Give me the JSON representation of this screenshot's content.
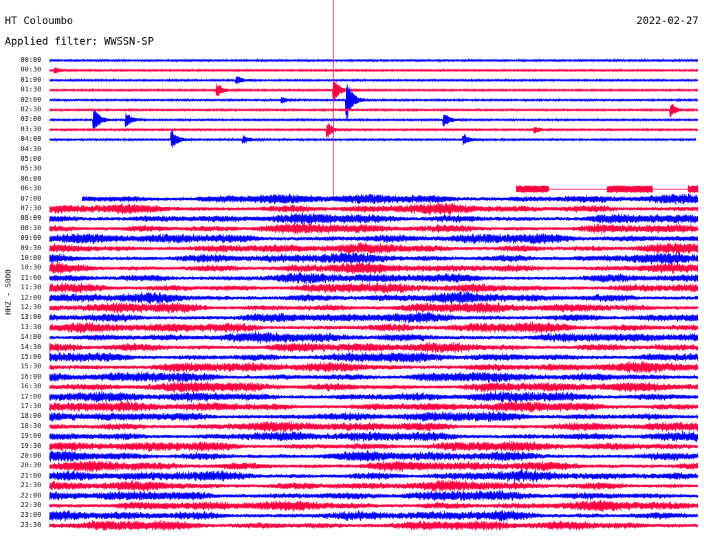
{
  "header": {
    "station": "HT Coloumbo",
    "date": "2022-02-27",
    "filter": "Applied filter: WWSSN-SP",
    "channel": "HHZ - 5000"
  },
  "colors": {
    "trace_a": "#0000ff",
    "trace_b": "#ff0040",
    "background": "#ffffff",
    "text": "#000000"
  },
  "chart_data": {
    "type": "line",
    "title": "HT Coloumbo",
    "date": "2022-02-27",
    "filter": "WWSSN-SP",
    "ylabel": "HHZ - 5000",
    "row_labels": [
      "00:00",
      "00:30",
      "01:00",
      "01:30",
      "02:00",
      "02:30",
      "03:00",
      "03:30",
      "04:00",
      "04:30",
      "05:00",
      "05:30",
      "06:00",
      "06:30",
      "07:00",
      "07:30",
      "08:00",
      "08:30",
      "09:00",
      "09:30",
      "10:00",
      "10:30",
      "11:00",
      "11:30",
      "12:00",
      "12:30",
      "13:00",
      "13:30",
      "14:00",
      "14:30",
      "15:00",
      "15:30",
      "16:00",
      "16:30",
      "17:00",
      "17:30",
      "18:00",
      "18:30",
      "19:00",
      "19:30",
      "20:00",
      "20:30",
      "21:00",
      "21:30",
      "22:00",
      "22:30",
      "23:00",
      "23:30"
    ],
    "trace_colors": [
      "#0000ff",
      "#ff0040"
    ],
    "rows_with_data_00_to_04": 9,
    "rows_without_data": [
      "04:30",
      "05:00",
      "05:30",
      "06:00"
    ],
    "high_noise_from": "07:00",
    "events": [
      {
        "row": "00:30",
        "t": 0.01,
        "amplitude": 0.5,
        "color": "#ff0040"
      },
      {
        "row": "01:00",
        "t": 0.29,
        "amplitude": 0.6
      },
      {
        "row": "01:30",
        "t": 0.26,
        "amplitude": 1.0
      },
      {
        "row": "01:30",
        "t": 0.44,
        "amplitude": 1.6
      },
      {
        "row": "02:00",
        "t": 0.36,
        "amplitude": 0.4
      },
      {
        "row": "02:00",
        "t": 0.46,
        "amplitude": 3.0
      },
      {
        "row": "02:30",
        "t": 0.96,
        "amplitude": 1.0
      },
      {
        "row": "03:00",
        "t": 0.07,
        "amplitude": 2.0
      },
      {
        "row": "03:00",
        "t": 0.12,
        "amplitude": 1.0
      },
      {
        "row": "03:00",
        "t": 0.61,
        "amplitude": 1.0
      },
      {
        "row": "03:30",
        "t": 0.43,
        "amplitude": 1.1
      },
      {
        "row": "03:30",
        "t": 0.75,
        "amplitude": 0.5
      },
      {
        "row": "04:00",
        "t": 0.19,
        "amplitude": 1.4
      },
      {
        "row": "04:00",
        "t": 0.3,
        "amplitude": 0.6
      },
      {
        "row": "04:00",
        "t": 0.64,
        "amplitude": 0.8
      }
    ],
    "spike": {
      "t": 0.44,
      "from": "00:00",
      "to": "07:00"
    }
  }
}
